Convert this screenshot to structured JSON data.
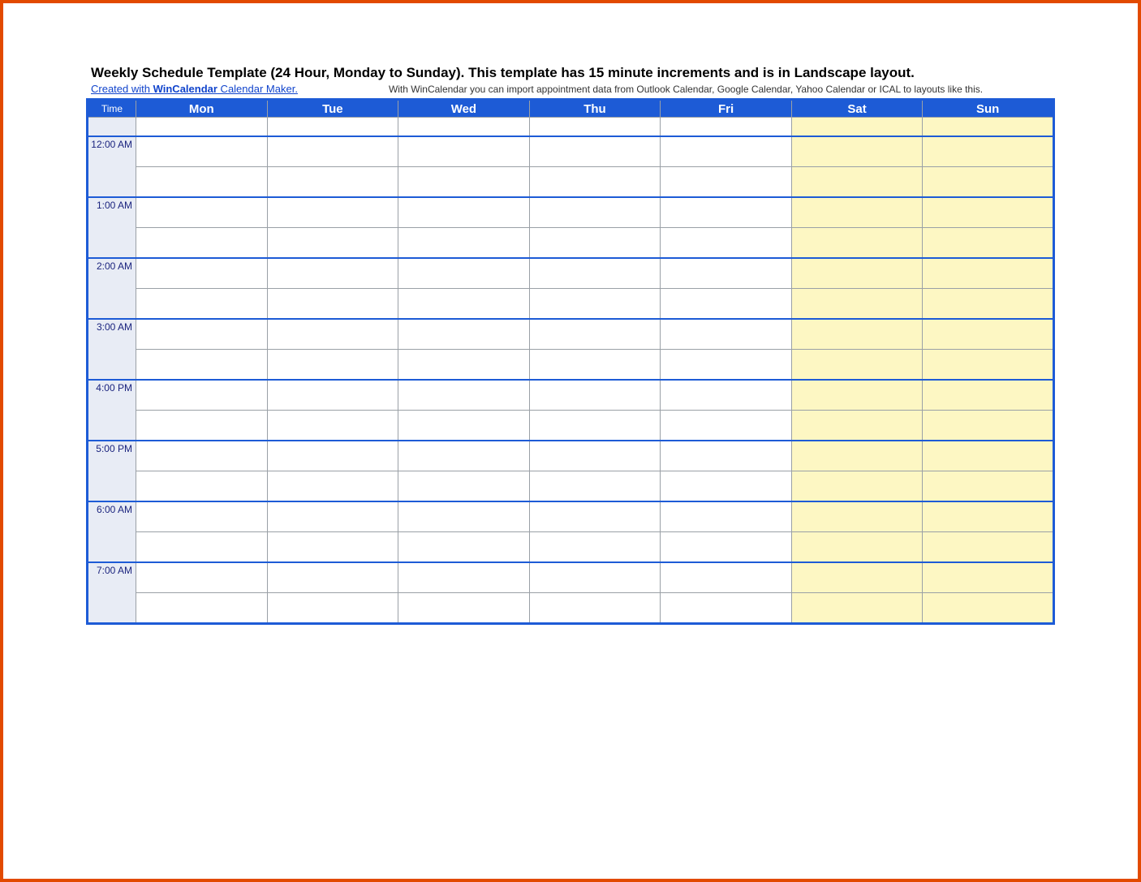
{
  "header": {
    "title": "Weekly Schedule Template (24 Hour, Monday to Sunday).  This template has 15 minute increments and is in Landscape layout.",
    "credit_prefix": "Created with ",
    "credit_brand": "WinCalendar",
    "credit_suffix": " Calendar Maker.",
    "info_note": "With WinCalendar you can import appointment data from Outlook Calendar, Google Calendar, Yahoo Calendar or ICAL to layouts like this."
  },
  "columns": {
    "time": "Time",
    "days": [
      "Mon",
      "Tue",
      "Wed",
      "Thu",
      "Fri",
      "Sat",
      "Sun"
    ]
  },
  "weekend_indices": [
    5,
    6
  ],
  "time_slots": [
    "12:00 AM",
    "1:00 AM",
    "2:00 AM",
    "3:00 AM",
    "4:00 PM",
    "5:00 PM",
    "6:00 AM",
    "7:00 AM"
  ],
  "rows_per_hour": 2
}
